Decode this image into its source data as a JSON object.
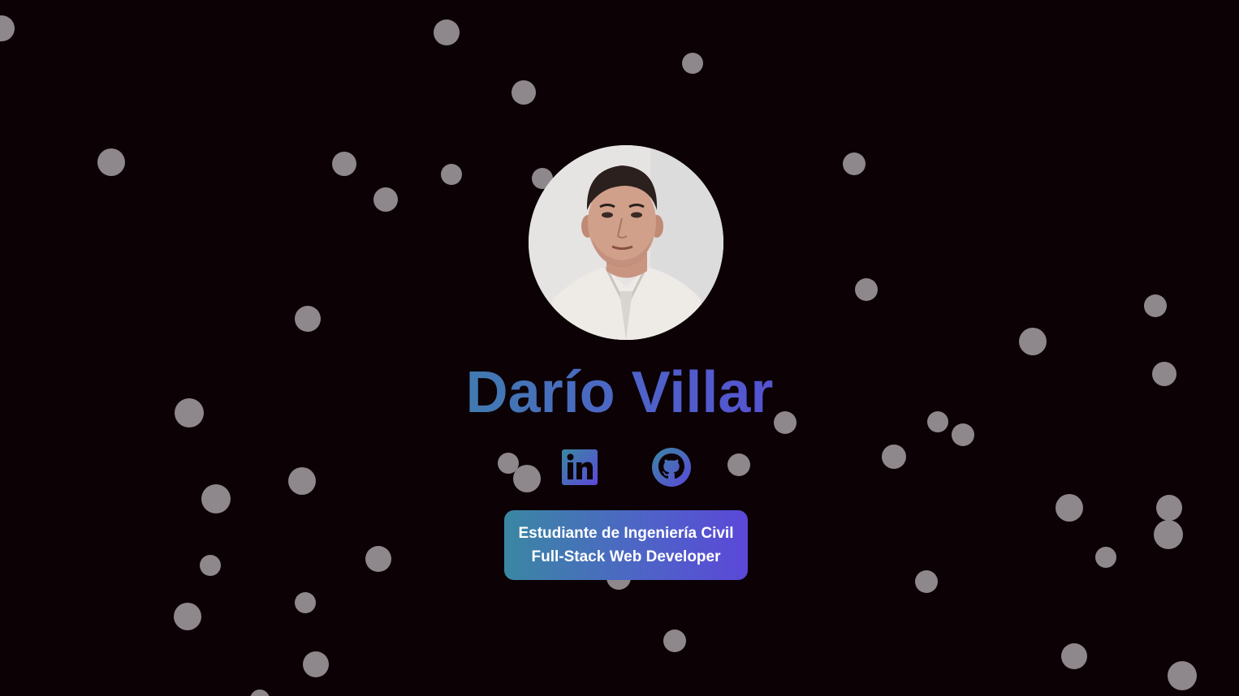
{
  "profile": {
    "name": "Darío Villar",
    "roles": [
      "Estudiante de Ingeniería Civil",
      "Full-Stack Web Developer"
    ]
  },
  "social_links": [
    {
      "icon": "linkedin-icon",
      "label": "LinkedIn"
    },
    {
      "icon": "github-icon",
      "label": "GitHub"
    }
  ],
  "colors": {
    "background": "#0c0206",
    "particle": "#8e878b",
    "gradient_start": "#3a87a3",
    "gradient_end": "#5b48d8"
  }
}
